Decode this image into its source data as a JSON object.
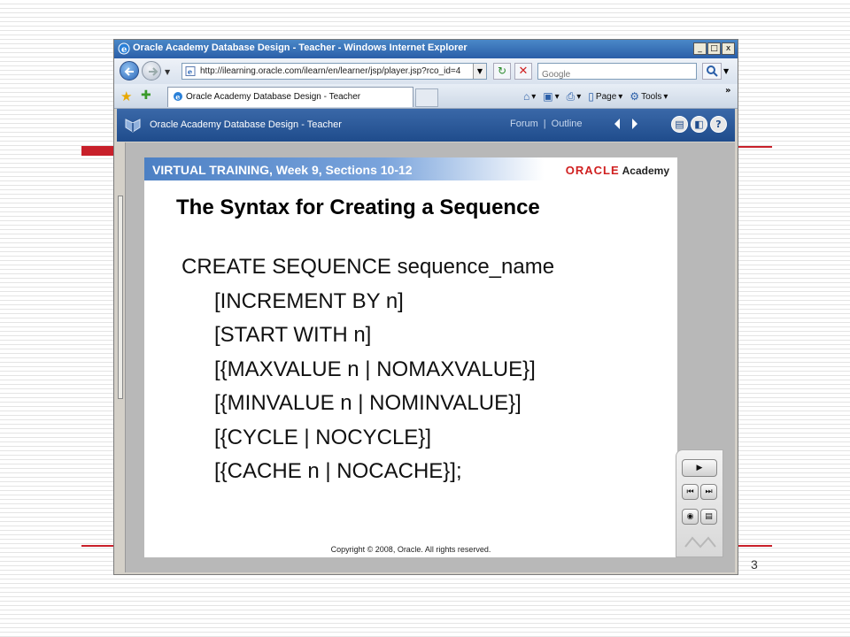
{
  "slide_deck": {
    "page_number": "3"
  },
  "browser": {
    "window_title": "Oracle Academy Database Design - Teacher - Windows Internet Explorer",
    "window_buttons": [
      "_",
      "□",
      "x"
    ],
    "address_url": "http://ilearning.oracle.com/ilearn/en/learner/jsp/player.jsp?rco_id=4",
    "search_placeholder": "Google",
    "tab_label": "Oracle Academy Database Design - Teacher",
    "commands": {
      "page": "Page",
      "tools": "Tools"
    }
  },
  "player": {
    "header_title": "Oracle Academy Database Design - Teacher",
    "forum_link": "Forum",
    "separator": "|",
    "outline_link": "Outline"
  },
  "slide": {
    "header_left": "VIRTUAL TRAINING, Week 9, Sections 10-12",
    "brand_oracle": "ORACLE",
    "brand_academy": "Academy",
    "title": "The Syntax for Creating a Sequence",
    "syntax_lines": [
      "CREATE SEQUENCE sequence_name",
      "[INCREMENT BY n]",
      "[START WITH n]",
      "[{MAXVALUE n | NOMAXVALUE}]",
      "[{MINVALUE n | NOMINVALUE}]",
      "[{CYCLE | NOCYCLE}]",
      "[{CACHE n | NOCACHE}];"
    ],
    "copyright": "Copyright © 2008, Oracle.  All rights reserved."
  },
  "colors": {
    "accent_red": "#c8202a",
    "header_blue": "#1f4c8c"
  }
}
